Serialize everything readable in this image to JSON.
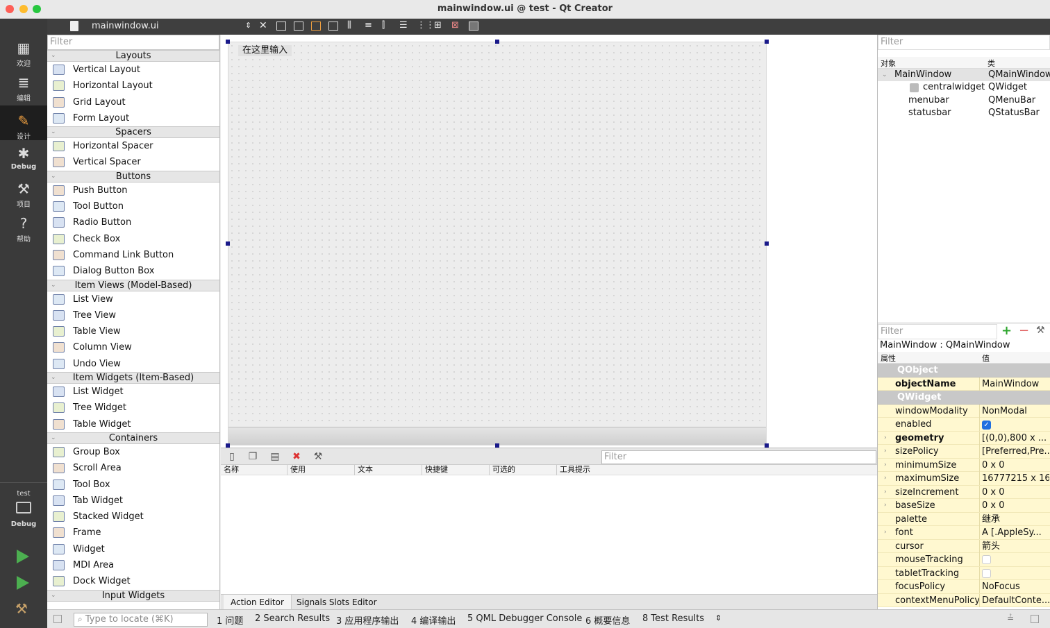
{
  "window": {
    "title": "mainwindow.ui @ test - Qt Creator"
  },
  "modes": [
    {
      "label": "欢迎",
      "icon": "grid-icon"
    },
    {
      "label": "编辑",
      "icon": "document-icon"
    },
    {
      "label": "设计",
      "icon": "pencil-icon"
    },
    {
      "label": "Debug",
      "icon": "bug-icon"
    },
    {
      "label": "项目",
      "icon": "wrench-icon"
    },
    {
      "label": "帮助",
      "icon": "help-icon"
    }
  ],
  "kit": {
    "project": "test",
    "config": "Debug"
  },
  "file_toolbar": {
    "filename": "mainwindow.ui"
  },
  "widget_box": {
    "filter_placeholder": "Filter",
    "categories": [
      {
        "name": "Layouts",
        "items": [
          "Vertical Layout",
          "Horizontal Layout",
          "Grid Layout",
          "Form Layout"
        ]
      },
      {
        "name": "Spacers",
        "items": [
          "Horizontal Spacer",
          "Vertical Spacer"
        ]
      },
      {
        "name": "Buttons",
        "items": [
          "Push Button",
          "Tool Button",
          "Radio Button",
          "Check Box",
          "Command Link Button",
          "Dialog Button Box"
        ]
      },
      {
        "name": "Item Views (Model-Based)",
        "items": [
          "List View",
          "Tree View",
          "Table View",
          "Column View",
          "Undo View"
        ]
      },
      {
        "name": "Item Widgets (Item-Based)",
        "items": [
          "List Widget",
          "Tree Widget",
          "Table Widget"
        ]
      },
      {
        "name": "Containers",
        "items": [
          "Group Box",
          "Scroll Area",
          "Tool Box",
          "Tab Widget",
          "Stacked Widget",
          "Frame",
          "Widget",
          "MDI Area",
          "Dock Widget"
        ]
      },
      {
        "name": "Input Widgets",
        "items": []
      }
    ]
  },
  "form": {
    "menu_placeholder": "在这里输入"
  },
  "action_editor": {
    "filter_placeholder": "Filter",
    "columns": [
      "名称",
      "使用",
      "文本",
      "快捷键",
      "可选的",
      "工具提示"
    ],
    "tabs": [
      "Action Editor",
      "Signals  Slots Editor"
    ]
  },
  "object_inspector": {
    "filter_placeholder": "Filter",
    "columns": [
      "对象",
      "类"
    ],
    "rows": [
      {
        "object": "MainWindow",
        "class": "QMainWindow"
      },
      {
        "object": "centralwidget",
        "class": "QWidget"
      },
      {
        "object": "menubar",
        "class": "QMenuBar"
      },
      {
        "object": "statusbar",
        "class": "QStatusBar"
      }
    ]
  },
  "property_editor": {
    "filter_placeholder": "Filter",
    "context": "MainWindow : QMainWindow",
    "columns": [
      "属性",
      "值"
    ],
    "rows": [
      {
        "group": "QObject"
      },
      {
        "name": "objectName",
        "value": "MainWindow",
        "bold": true
      },
      {
        "group": "QWidget"
      },
      {
        "name": "windowModality",
        "value": "NonModal"
      },
      {
        "name": "enabled",
        "value": "",
        "check": true
      },
      {
        "name": "geometry",
        "value": "[(0,0),800 x ...",
        "bold": true,
        "expand": true
      },
      {
        "name": "sizePolicy",
        "value": "[Preferred,Pre...",
        "expand": true
      },
      {
        "name": "minimumSize",
        "value": "0 x 0",
        "expand": true
      },
      {
        "name": "maximumSize",
        "value": "16777215 x 16...",
        "expand": true
      },
      {
        "name": "sizeIncrement",
        "value": "0 x 0",
        "expand": true
      },
      {
        "name": "baseSize",
        "value": "0 x 0",
        "expand": true
      },
      {
        "name": "palette",
        "value": "继承"
      },
      {
        "name": "font",
        "value": "A  [.AppleSy...",
        "expand": true
      },
      {
        "name": "cursor",
        "value": "箭头"
      },
      {
        "name": "mouseTracking",
        "value": "",
        "check": false
      },
      {
        "name": "tabletTracking",
        "value": "",
        "check": false
      },
      {
        "name": "focusPolicy",
        "value": "NoFocus"
      },
      {
        "name": "contextMenuPolicy",
        "value": "DefaultConte..."
      }
    ]
  },
  "bottom_bar": {
    "locator_placeholder": "Type to locate (⌘K)",
    "tabs": [
      "1  问题",
      "2  Search Results",
      "3  应用程序输出",
      "4  编译输出",
      "5  QML Debugger Console",
      "6  概要信息",
      "8  Test Results"
    ]
  },
  "colors": {
    "accent": "#1a1a8a",
    "modebar": "#3a3a3a",
    "property_row": "#fff8d0",
    "run_green": "#4caf50"
  }
}
